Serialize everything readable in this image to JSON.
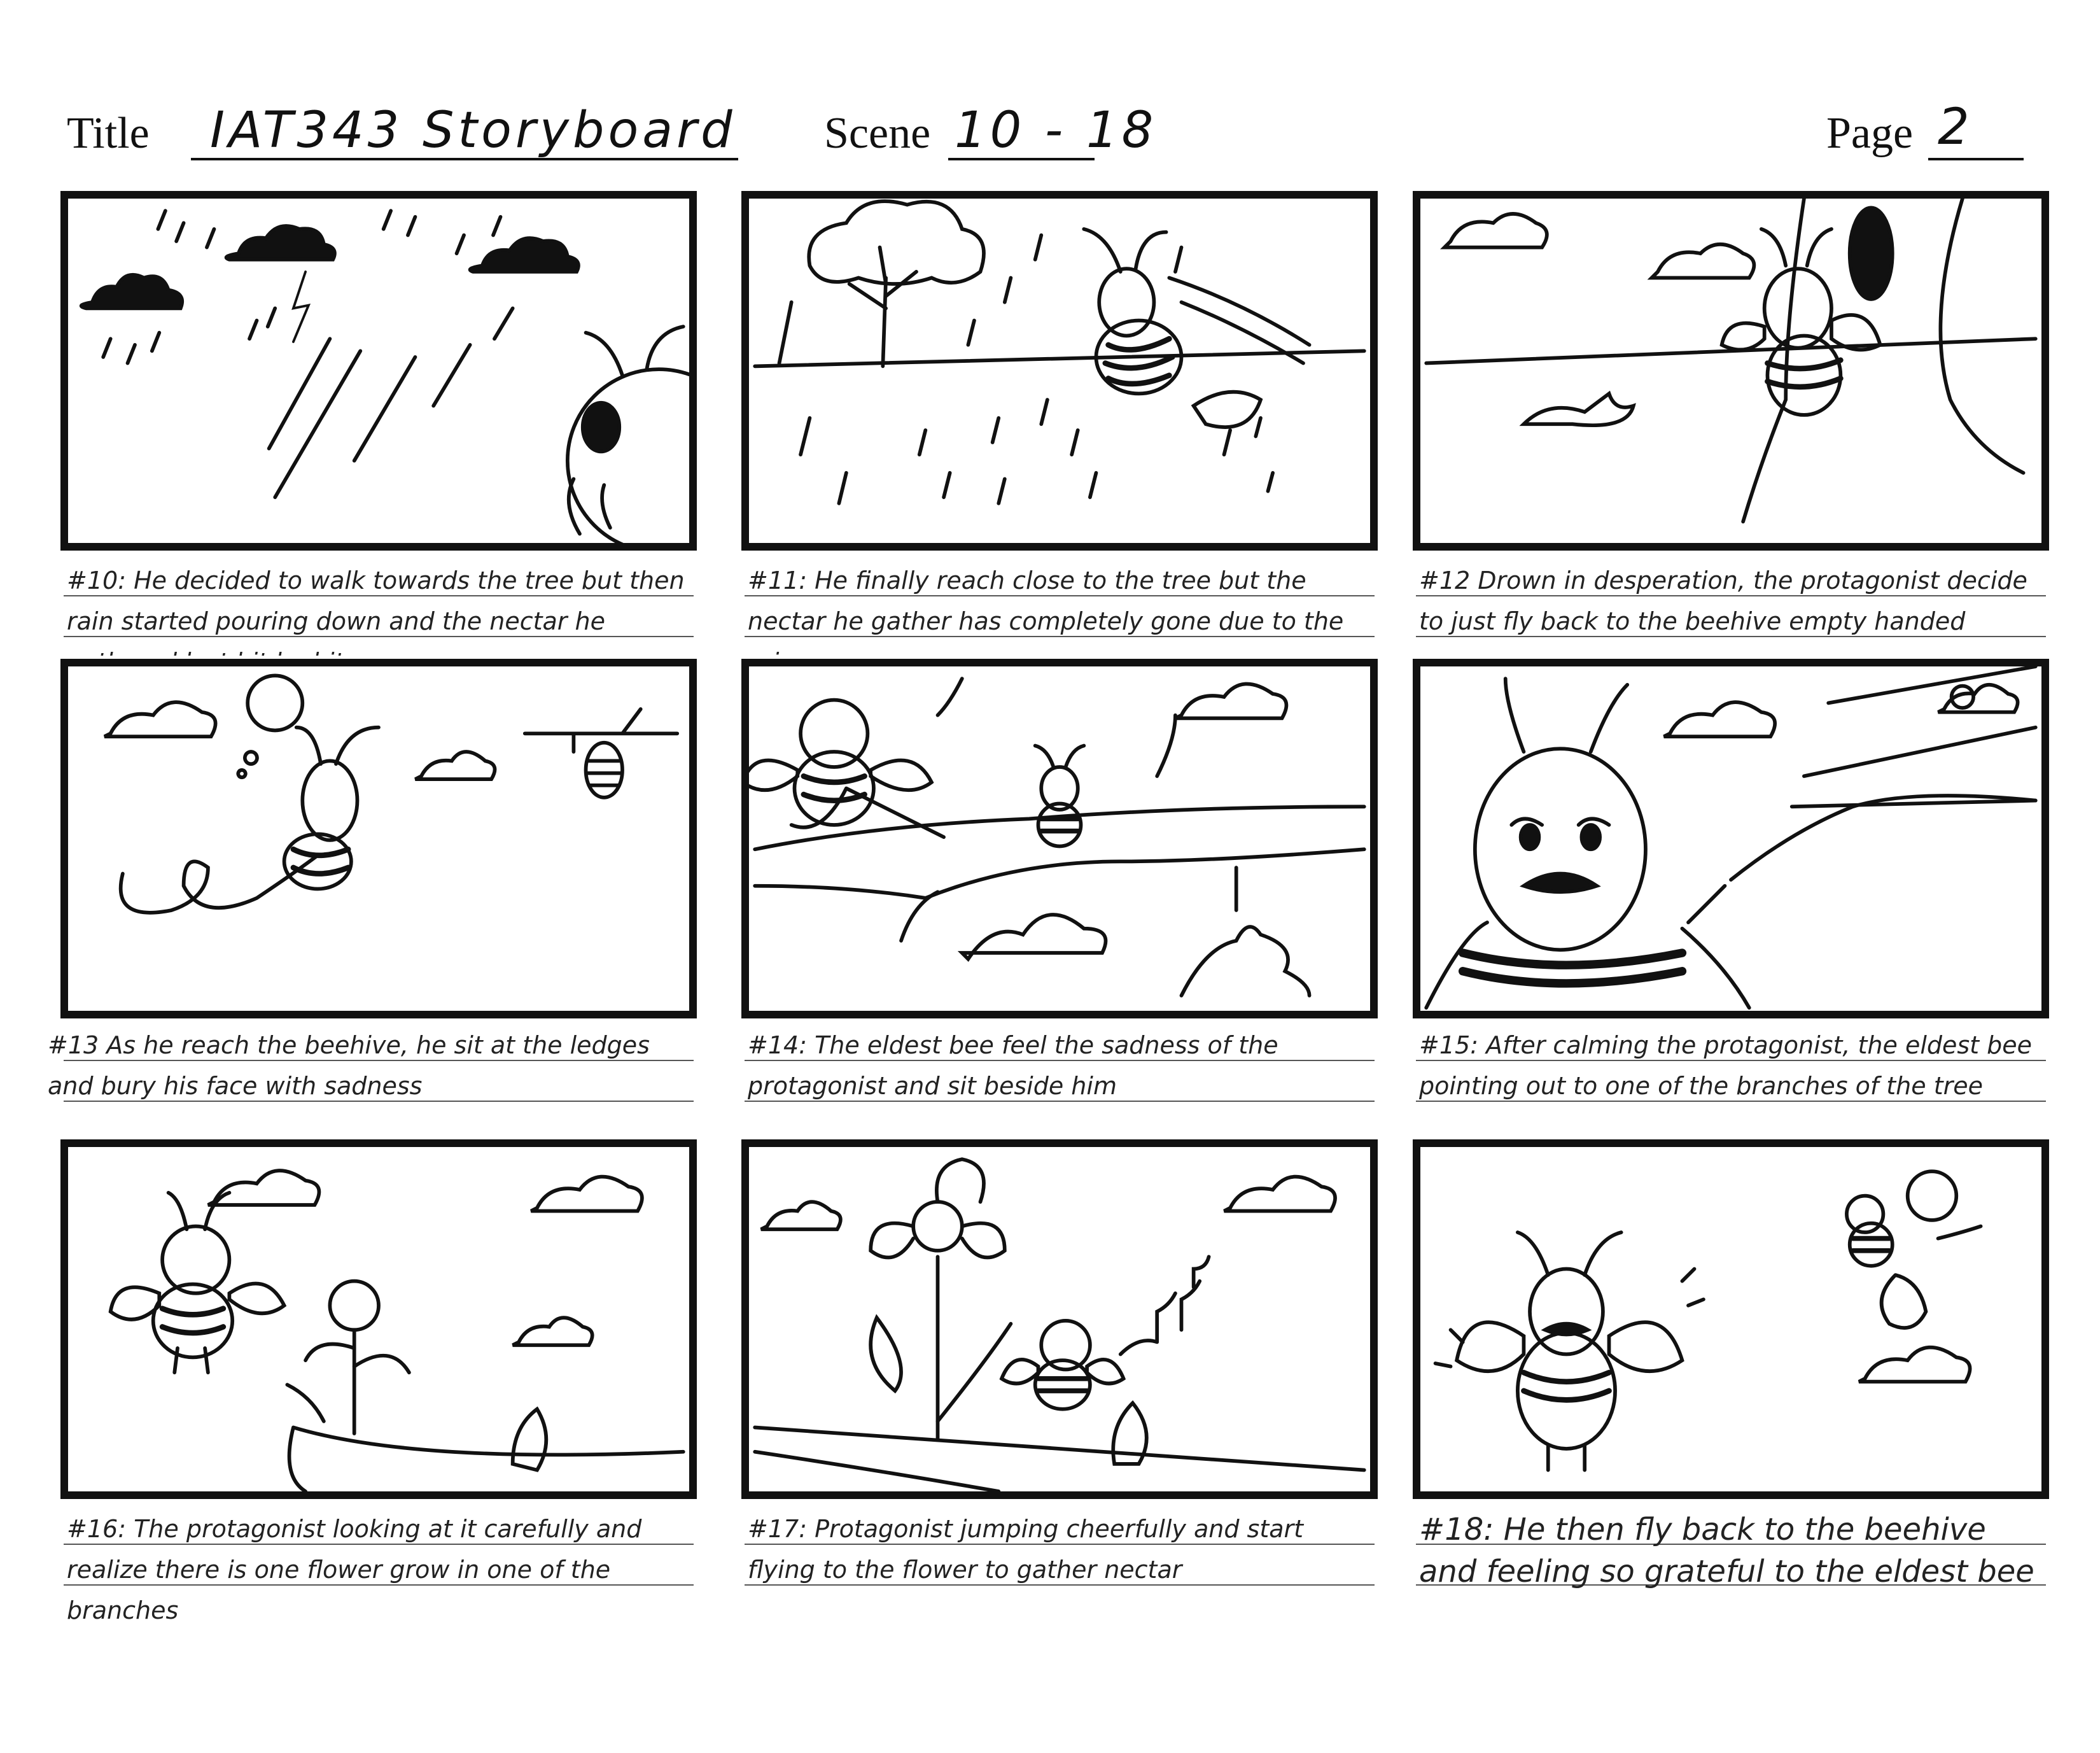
{
  "header": {
    "title_label": "Title",
    "title_value": "IAT343 Storyboard",
    "scene_label": "Scene",
    "scene_value": "10 - 18",
    "page_label": "Page",
    "page_value": "2"
  },
  "panels": [
    {
      "caption": "#10: He decided to walk towards the tree but then rain started pouring down and the nectar he gathered lost bit by bit"
    },
    {
      "caption": "#11: He finally reach close to the tree but the nectar he gather has completely gone due to the rain"
    },
    {
      "caption": "#12 Drown in desperation, the protagonist decide to just fly back to the beehive empty handed"
    },
    {
      "caption": "#13 As he reach the beehive, he sit at the ledges and bury his face with sadness"
    },
    {
      "caption": "#14: The eldest bee feel the sadness of the protagonist and sit beside him"
    },
    {
      "caption": "#15: After calming the protagonist, the eldest bee pointing out to one of the branches of the tree"
    },
    {
      "caption": "#16: The protagonist looking at it carefully and realize there is one flower grow in one of the branches"
    },
    {
      "caption": "#17: Protagonist jumping cheerfully and start flying to the flower to gather nectar"
    },
    {
      "caption": "#18: He then fly back to the beehive and feeling so grateful to the eldest bee"
    }
  ]
}
